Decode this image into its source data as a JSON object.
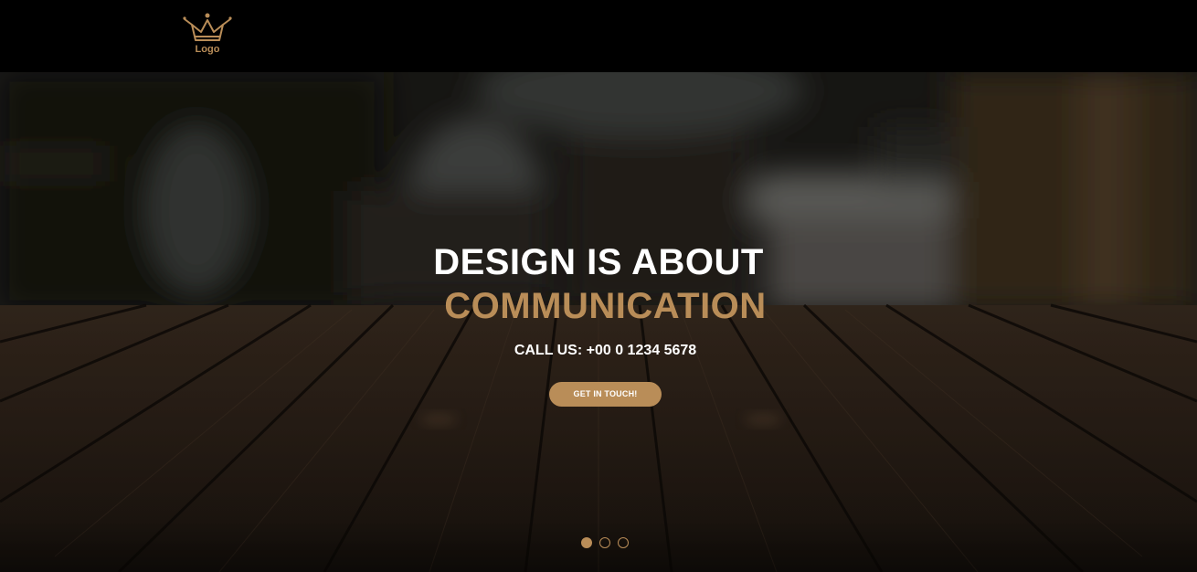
{
  "header": {
    "logo_text": "Logo"
  },
  "hero": {
    "headline_line1": "DESIGN IS ABOUT",
    "headline_line2": "COMMUNICATION",
    "call_us": "CALL US: +00 0 1234 5678",
    "cta_label": "GET IN TOUCH!",
    "slider": {
      "total_slides": 3,
      "active_slide": 1
    }
  },
  "colors": {
    "accent": "#b98d58",
    "header_bg": "#000000",
    "text_primary": "#ffffff"
  }
}
